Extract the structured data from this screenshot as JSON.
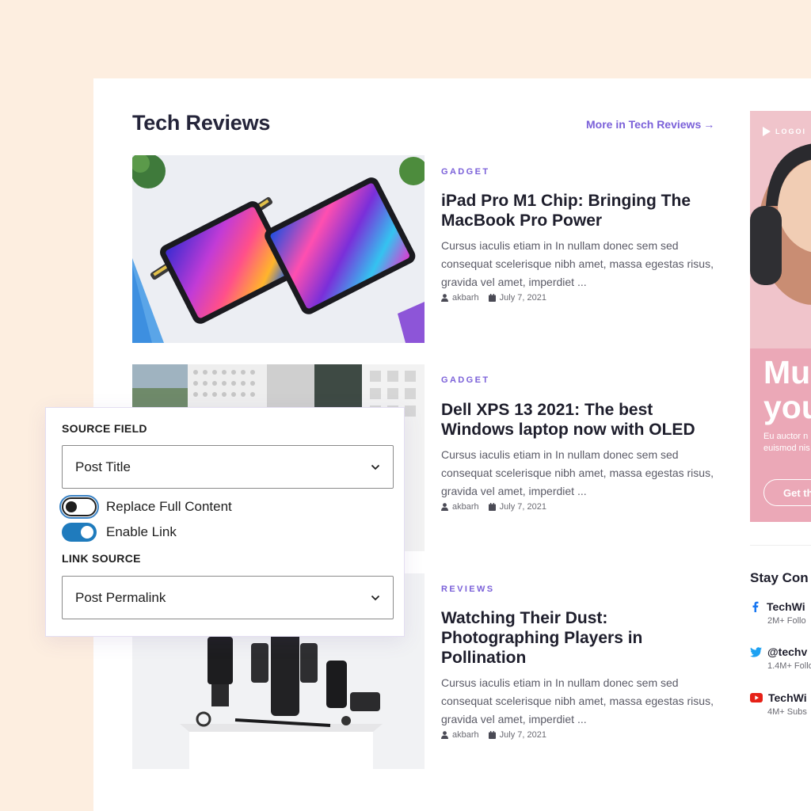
{
  "section": {
    "title": "Tech Reviews",
    "more_link": "More in Tech Reviews",
    "more_arrow": "→"
  },
  "posts": [
    {
      "category": "GADGET",
      "title": "iPad Pro M1 Chip: Bringing The MacBook Pro Power",
      "excerpt": "Cursus iaculis etiam in In nullam donec sem sed consequat scelerisque nibh amet, massa egestas risus, gravida vel amet, imperdiet ...",
      "author": "akbarh",
      "date": "July 7, 2021"
    },
    {
      "category": "GADGET",
      "title": "Dell XPS 13 2021: The best Windows laptop now with OLED",
      "excerpt": "Cursus iaculis etiam in In nullam donec sem sed consequat scelerisque nibh amet, massa egestas risus, gravida vel amet, imperdiet ...",
      "author": "akbarh",
      "date": "July 7, 2021"
    },
    {
      "category": "REVIEWS",
      "title": "Watching Their Dust: Photographing Players in Pollination",
      "excerpt": "Cursus iaculis etiam in In nullam donec sem sed consequat scelerisque nibh amet, massa egestas risus, gravida vel amet, imperdiet ...",
      "author": "akbarh",
      "date": "July 7, 2021"
    }
  ],
  "settings": {
    "source_field_label": "SOURCE FIELD",
    "source_field_value": "Post Title",
    "replace_full_content_label": "Replace Full Content",
    "replace_full_content_on": false,
    "enable_link_label": "Enable Link",
    "enable_link_on": true,
    "link_source_label": "LINK SOURCE",
    "link_source_value": "Post Permalink"
  },
  "ad": {
    "logo_text": "LOGOI",
    "headline": "Mu\nyou",
    "subtext": "Eu auctor n\neuismod nis",
    "button": "Get th"
  },
  "sidebar": {
    "stay_title": "Stay Con",
    "social": [
      {
        "icon": "facebook-icon",
        "name": "TechWi",
        "count": "2M+ Follo"
      },
      {
        "icon": "twitter-icon",
        "name": "@techv",
        "count": "1.4M+ Follo"
      },
      {
        "icon": "youtube-icon",
        "name": "TechWi",
        "count": "4M+ Subs"
      }
    ]
  },
  "colors": {
    "accent": "#7b61d9",
    "toggle_on": "#1f7bbd",
    "page_bg": "#fdeee0",
    "facebook": "#1877f2",
    "twitter": "#1da1f2",
    "youtube": "#e62117"
  }
}
